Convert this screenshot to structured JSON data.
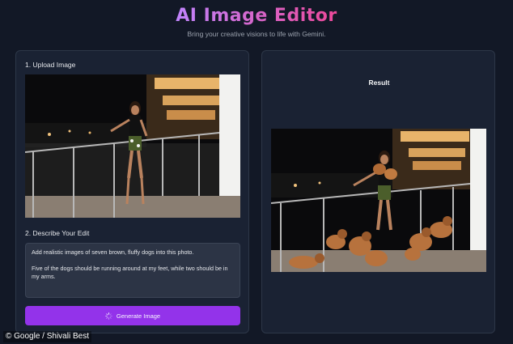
{
  "header": {
    "title": "AI Image Editor",
    "subtitle": "Bring your creative visions to life with Gemini."
  },
  "upload": {
    "label": "1. Upload Image"
  },
  "edit": {
    "label": "2. Describe Your Edit",
    "prompt_value": "Add realistic images of seven brown, fluffy dogs into this photo.\n\nFive of the dogs should be running around at my feet, while two should be in my arms."
  },
  "generate": {
    "button_label": "Generate Image",
    "icon": "spinner-icon"
  },
  "result": {
    "label": "Result"
  },
  "credit": "© Google / Shivali Best",
  "colors": {
    "background": "#121826",
    "panel": "#1a2233",
    "accent": "#9333ea",
    "title_gradient_start": "#c084fc",
    "title_gradient_end": "#ec4899"
  }
}
